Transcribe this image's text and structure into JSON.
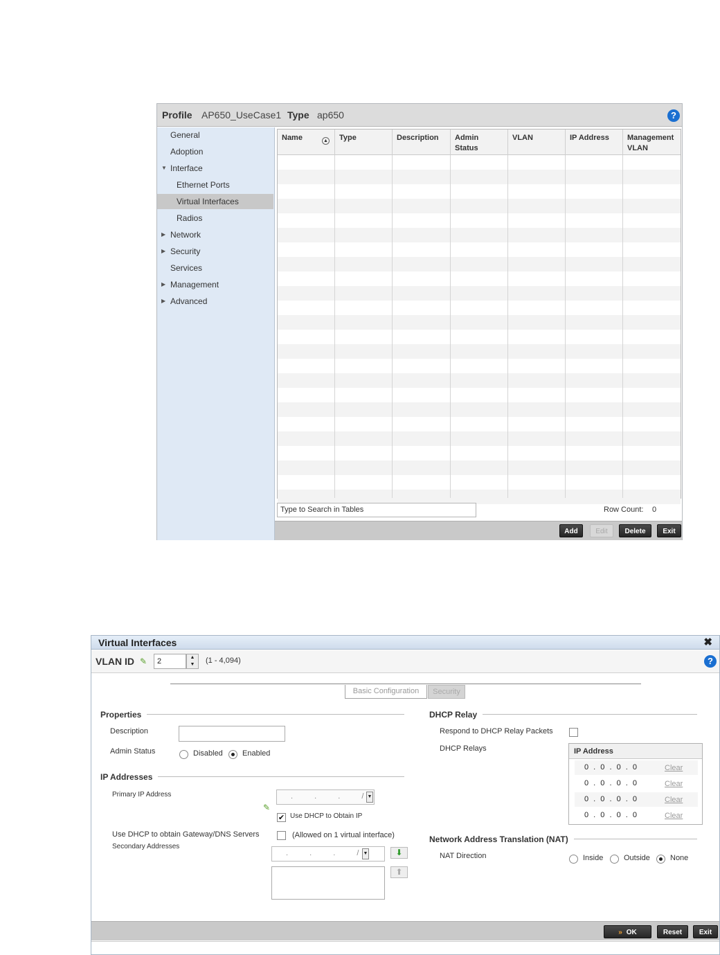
{
  "profile_panel": {
    "header": {
      "profile_label": "Profile",
      "profile_value": "AP650_UseCase1",
      "type_label": "Type",
      "type_value": "ap650",
      "help_icon": "?"
    },
    "nav": [
      {
        "label": "General",
        "arrow": ""
      },
      {
        "label": "Adoption",
        "arrow": ""
      },
      {
        "label": "Interface",
        "arrow": "▼"
      },
      {
        "label": "Ethernet Ports",
        "arrow": ""
      },
      {
        "label": "Virtual Interfaces",
        "arrow": "",
        "selected": true
      },
      {
        "label": "Radios",
        "arrow": ""
      },
      {
        "label": "Network",
        "arrow": "▶"
      },
      {
        "label": "Security",
        "arrow": "▶"
      },
      {
        "label": "Services",
        "arrow": ""
      },
      {
        "label": "Management",
        "arrow": "▶"
      },
      {
        "label": "Advanced",
        "arrow": "▶"
      }
    ],
    "table": {
      "columns": [
        "Name",
        "Type",
        "Description",
        "Admin Status",
        "VLAN",
        "IP Address",
        "Management VLAN"
      ],
      "sort_icon": "sort-ascending-icon",
      "rows": []
    },
    "search_placeholder": "Type to Search in Tables",
    "row_count_label": "Row Count:",
    "row_count_value": "0",
    "buttons": {
      "add": "Add",
      "edit": "Edit",
      "delete": "Delete",
      "exit": "Exit"
    }
  },
  "virtual_interfaces_dialog": {
    "title": "Virtual Interfaces",
    "close_icon": "✖",
    "vlan_label": "VLAN ID",
    "vlan_value": "2",
    "vlan_range": "(1 - 4,094)",
    "help_icon": "?",
    "tabs": [
      "Basic Configuration",
      "Security"
    ],
    "properties": {
      "heading": "Properties",
      "description_label": "Description",
      "description_value": "",
      "admin_status_label": "Admin Status",
      "admin_status_options": [
        "Disabled",
        "Enabled"
      ],
      "admin_status_selected": "Enabled"
    },
    "ip_addresses": {
      "heading": "IP Addresses",
      "primary_label": "Primary IP Address",
      "use_dhcp_label": "Use DHCP to Obtain IP",
      "use_dhcp_checked": true,
      "gateway_label": "Use DHCP to obtain Gateway/DNS Servers",
      "gateway_note": "(Allowed on 1 virtual interface)",
      "gateway_checked": false,
      "secondary_label": "Secondary Addresses"
    },
    "dhcp_relay": {
      "heading": "DHCP Relay",
      "respond_label": "Respond to DHCP Relay Packets",
      "respond_checked": false,
      "relays_label": "DHCP Relays",
      "column": "IP Address",
      "rows": [
        {
          "ip": "0 . 0 . 0 . 0",
          "action": "Clear"
        },
        {
          "ip": "0 . 0 . 0 . 0",
          "action": "Clear"
        },
        {
          "ip": "0 . 0 . 0 . 0",
          "action": "Clear"
        },
        {
          "ip": "0 . 0 . 0 . 0",
          "action": "Clear"
        }
      ]
    },
    "nat": {
      "heading": "Network Address Translation (NAT)",
      "direction_label": "NAT Direction",
      "options": [
        "Inside",
        "Outside",
        "None"
      ],
      "selected": "None"
    },
    "buttons": {
      "ok": "OK",
      "reset": "Reset",
      "exit": "Exit"
    }
  }
}
